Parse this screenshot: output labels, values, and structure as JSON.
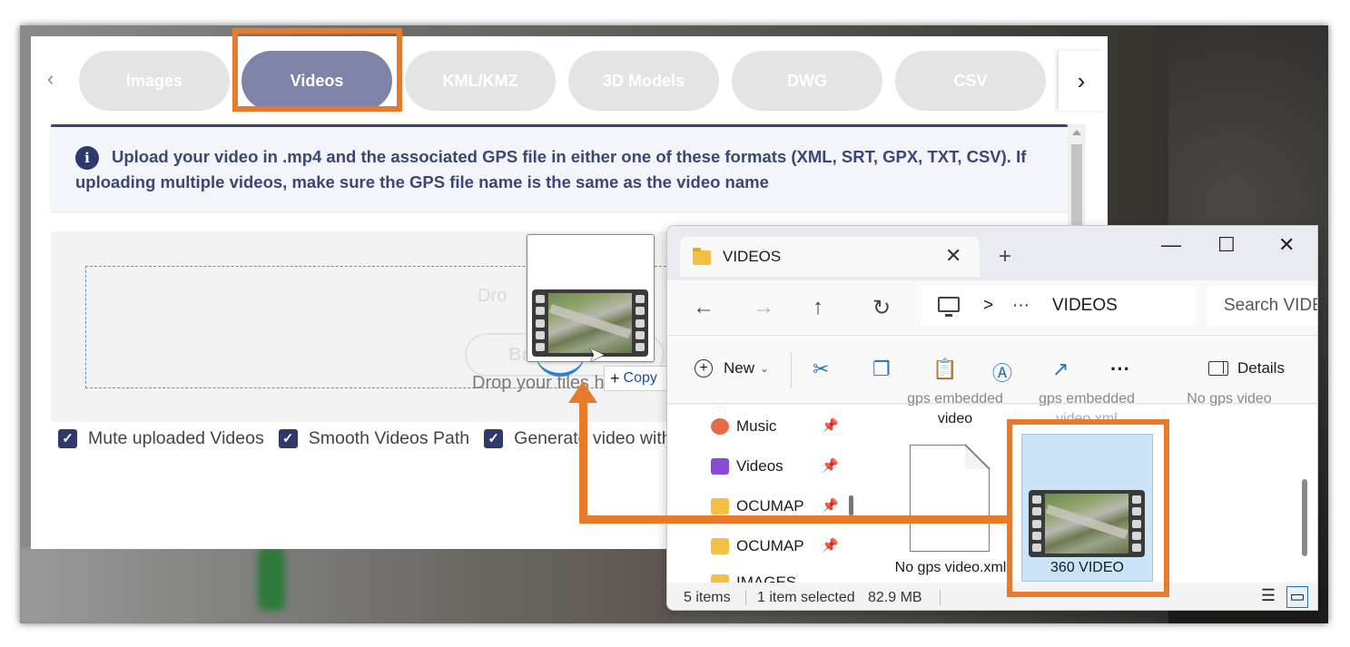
{
  "tabs": [
    {
      "label": "Images",
      "active": false
    },
    {
      "label": "Videos",
      "active": true
    },
    {
      "label": "KML/KMZ",
      "active": false
    },
    {
      "label": "3D Models",
      "active": false
    },
    {
      "label": "DWG",
      "active": false
    },
    {
      "label": "CSV",
      "active": false
    }
  ],
  "info": {
    "icon": "info-icon",
    "icon_glyph": "i",
    "text": "Upload your video in .mp4 and the associated GPS file in either one of these formats (XML, SRT, GPX, TXT, CSV). If uploading multiple videos, make sure the GPS file name is the same as the video name"
  },
  "dropzone": {
    "faint_text": "Dro",
    "browse_faint": "Brow",
    "text": "Drop your files here"
  },
  "checkboxes": [
    {
      "label": "Mute uploaded Videos",
      "checked": true
    },
    {
      "label": "Smooth Videos Path",
      "checked": true
    },
    {
      "label": "Generate video with",
      "checked": true
    }
  ],
  "drag": {
    "copy_label": "Copy",
    "copy_prefix": "+"
  },
  "explorer": {
    "tab_title": "VIDEOS",
    "address_sep": ">",
    "address_more": "···",
    "address_folder": "VIDEOS",
    "search_placeholder": "Search VIDE",
    "new_label": "New",
    "details_label": "Details",
    "nav_items": [
      {
        "label": "Music",
        "icon": "music-icon"
      },
      {
        "label": "Videos",
        "icon": "videos-icon"
      },
      {
        "label": "OCUMAP",
        "icon": "folder-icon"
      },
      {
        "label": "OCUMAP",
        "icon": "folder-icon"
      },
      {
        "label": "IMAGES",
        "icon": "folder-icon"
      }
    ],
    "files_partial": [
      "gps embedded",
      "video",
      "gps embedded",
      "video.xml",
      "No gps video"
    ],
    "files": [
      {
        "label": "No gps video.xml",
        "icon": "document-icon"
      },
      {
        "label": "360 VIDEO",
        "icon": "video-file-icon",
        "selected": true
      }
    ],
    "status": {
      "items": "5 items",
      "selected": "1 item selected",
      "size": "82.9 MB"
    }
  },
  "colors": {
    "accent_orange": "#e87a2e",
    "tab_active": "#7e84a8",
    "info_text": "#3d4675",
    "checkbox": "#2f3a6c"
  }
}
